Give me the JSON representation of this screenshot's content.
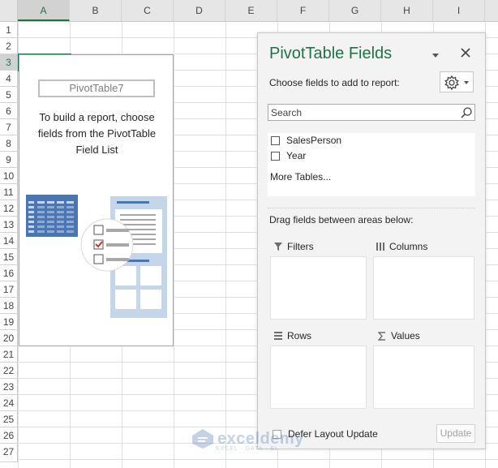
{
  "columns": [
    "A",
    "B",
    "C",
    "D",
    "E",
    "F",
    "G",
    "H",
    "I"
  ],
  "rows": [
    "1",
    "2",
    "3",
    "4",
    "5",
    "6",
    "7",
    "8",
    "9",
    "10",
    "11",
    "12",
    "13",
    "14",
    "15",
    "16",
    "17",
    "18",
    "19",
    "20",
    "21",
    "22",
    "23",
    "24",
    "25",
    "26",
    "27"
  ],
  "pivot_placeholder": {
    "name": "PivotTable7",
    "message_line1": "To build a report, choose",
    "message_line2": "fields from the PivotTable",
    "message_line3": "Field List"
  },
  "panel": {
    "title": "PivotTable Fields",
    "choose_label": "Choose fields to add to report:",
    "search_placeholder": "Search",
    "fields": [
      "SalesPerson",
      "Year"
    ],
    "more_tables": "More Tables...",
    "drag_label": "Drag fields between areas below:",
    "areas": {
      "filters": "Filters",
      "columns": "Columns",
      "rows": "Rows",
      "values": "Values"
    },
    "defer_label": "Defer Layout Update",
    "update_label": "Update"
  },
  "watermark": {
    "brand": "exceldemy",
    "tagline": "EXCEL · DATA · BI"
  },
  "colors": {
    "accent": "#217346",
    "illustration_blue": "#4a77b4",
    "illustration_light": "#c5d5ea"
  }
}
